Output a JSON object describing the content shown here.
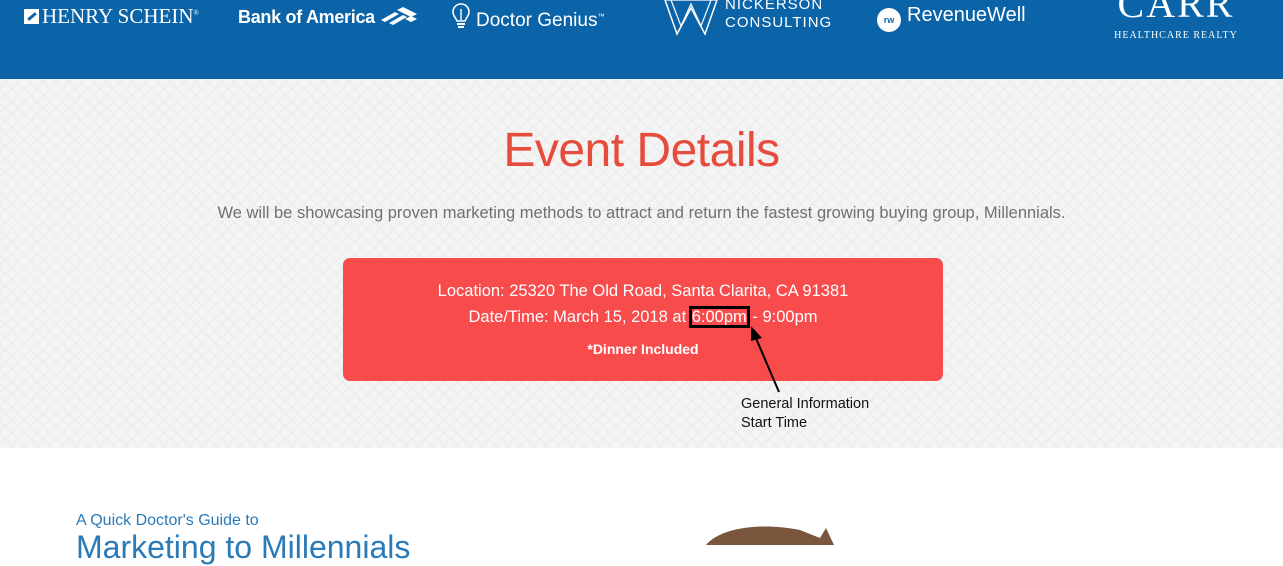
{
  "sponsors": {
    "henry_schein": "HENRY SCHEIN",
    "henry_schein_mark": "®",
    "bank_of_america": "Bank of America",
    "doctor_genius": "Doctor Genius",
    "doctor_genius_mark": "™",
    "nickerson_line1": "NICKERSON",
    "nickerson_line2": "CONSULTING",
    "revenuewell_badge": "rw",
    "revenuewell": "RevenueWell",
    "carr": "CARR",
    "carr_sub": "HEALTHCARE REALTY"
  },
  "event": {
    "title": "Event Details",
    "description": "We will be showcasing proven marketing methods to attract and return the fastest growing buying group, Millennials.",
    "location": "Location: 25320 The Old Road, Santa Clarita, CA 91381",
    "datetime_prefix": "Date/Time: March 15, 2018 at ",
    "start_time": "6:00pm",
    "datetime_suffix": " - 9:00pm",
    "dinner": "*Dinner Included"
  },
  "annotation": {
    "line1": "General Information",
    "line2": "Start Time"
  },
  "guide": {
    "kicker": "A Quick Doctor's Guide to",
    "title": "Marketing to Millennials"
  },
  "colors": {
    "banner": "#0b63a8",
    "title": "#e64c3c",
    "event_box": "#f84c4c",
    "guide_text": "#2a7ab8"
  },
  "icons": [
    "henry-schein-logo-icon",
    "bank-of-america-flag-icon",
    "lightbulb-icon",
    "nickerson-w-icon",
    "revenuewell-badge-icon",
    "annotation-arrow-icon",
    "illustration-shape-icon"
  ]
}
